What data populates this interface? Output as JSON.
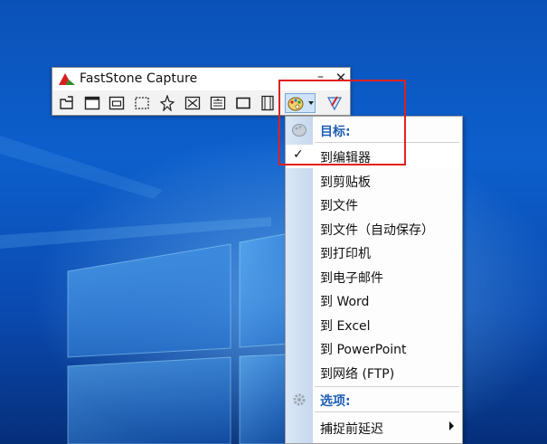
{
  "window": {
    "title": "FastStone Capture",
    "minimize_label": "–",
    "close_label": "✕"
  },
  "toolbar": {
    "buttons": [
      {
        "name": "open-file",
        "icon": "open-folder-icon"
      },
      {
        "name": "capture-active-window",
        "icon": "window-icon"
      },
      {
        "name": "capture-window-object",
        "icon": "window-object-icon"
      },
      {
        "name": "capture-rectangle",
        "icon": "dashed-rect-icon"
      },
      {
        "name": "capture-freehand",
        "icon": "freehand-star-icon"
      },
      {
        "name": "capture-full-screen",
        "icon": "full-screen-icon"
      },
      {
        "name": "capture-scrolling",
        "icon": "scrolling-window-icon"
      },
      {
        "name": "capture-fixed-region",
        "icon": "fixed-rect-icon"
      },
      {
        "name": "screen-recorder",
        "icon": "film-icon"
      },
      {
        "name": "output-destination",
        "icon": "palette-icon"
      },
      {
        "name": "settings",
        "icon": "brush-triangle-icon"
      }
    ]
  },
  "menu": {
    "target_header": "目标:",
    "items": [
      {
        "label": "到编辑器",
        "checked": true
      },
      {
        "label": "到剪贴板",
        "checked": false
      },
      {
        "label": "到文件",
        "checked": false
      },
      {
        "label": "到文件（自动保存）",
        "checked": false
      },
      {
        "label": "到打印机",
        "checked": false
      },
      {
        "label": "到电子邮件",
        "checked": false
      },
      {
        "label": "到 Word",
        "checked": false
      },
      {
        "label": "到 Excel",
        "checked": false
      },
      {
        "label": "到 PowerPoint",
        "checked": false
      },
      {
        "label": "到网络 (FTP)",
        "checked": false
      }
    ],
    "options_header": "选项:",
    "options_items": [
      {
        "label": "捕捉前延迟",
        "submenu": true
      }
    ],
    "check_glyph": "✓"
  },
  "colors": {
    "highlight": "#e02020",
    "header_text": "#1f5fb4"
  }
}
